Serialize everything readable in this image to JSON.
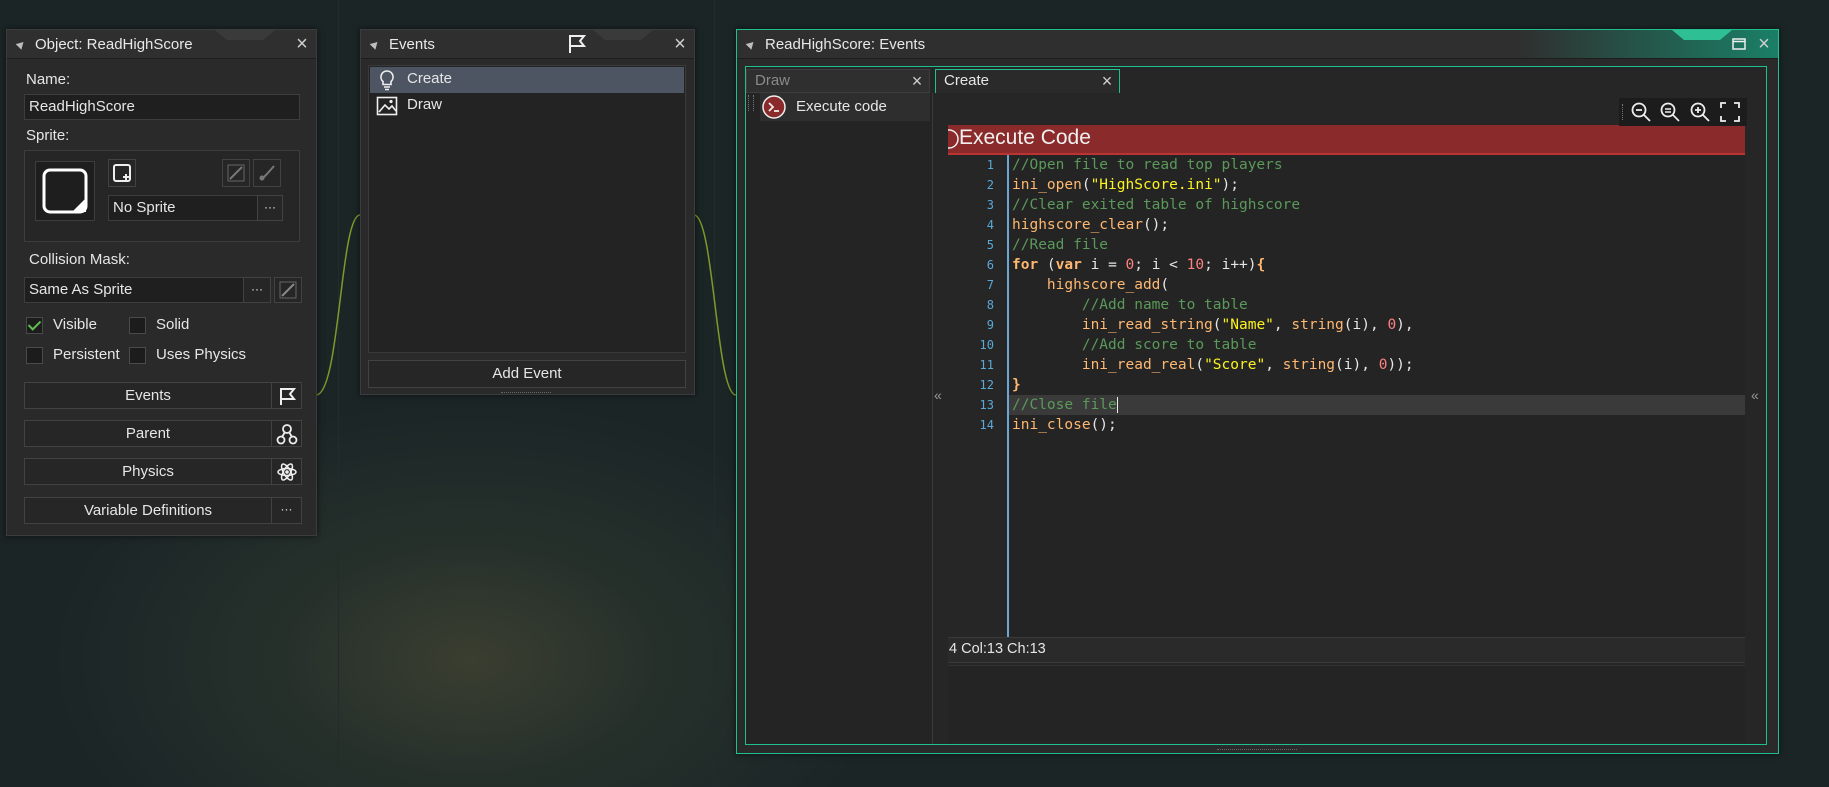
{
  "object_panel": {
    "title": "Object: ReadHighScore",
    "name_label": "Name:",
    "name_value": "ReadHighScore",
    "sprite_label": "Sprite:",
    "sprite_value": "No Sprite",
    "collision_label": "Collision Mask:",
    "collision_value": "Same As Sprite",
    "visible_label": "Visible",
    "visible_checked": true,
    "solid_label": "Solid",
    "persistent_label": "Persistent",
    "physics_label": "Uses Physics",
    "events_btn": "Events",
    "parent_btn": "Parent",
    "physics_btn": "Physics",
    "vardefs_btn": "Variable Definitions",
    "more_glyph": "···"
  },
  "events_panel": {
    "title": "Events",
    "items": [
      {
        "label": "Create",
        "icon": "lightbulb-icon",
        "selected": true
      },
      {
        "label": "Draw",
        "icon": "image-icon",
        "selected": false
      }
    ],
    "add_event_label": "Add Event"
  },
  "code_panel": {
    "title": "ReadHighScore: Events",
    "tabs": [
      {
        "label": "Draw",
        "active": false
      },
      {
        "label": "Create",
        "active": true
      }
    ],
    "action_label": "Execute code",
    "code_header": "Execute Code",
    "status": "4 Col:13 Ch:13",
    "lines": [
      {
        "n": "1",
        "indent": "",
        "tokens": [
          {
            "t": "//Open file to read top players",
            "c": "com"
          }
        ]
      },
      {
        "n": "2",
        "indent": "",
        "tokens": [
          {
            "t": "ini_open",
            "c": "fn"
          },
          {
            "t": "(",
            "c": "plain"
          },
          {
            "t": "\"HighScore.ini\"",
            "c": "str"
          },
          {
            "t": ");",
            "c": "plain"
          }
        ]
      },
      {
        "n": "3",
        "indent": "",
        "tokens": [
          {
            "t": "//Clear exited table of highscore",
            "c": "com"
          }
        ]
      },
      {
        "n": "4",
        "indent": "",
        "tokens": [
          {
            "t": "highscore_clear",
            "c": "fn"
          },
          {
            "t": "();",
            "c": "plain"
          }
        ]
      },
      {
        "n": "5",
        "indent": "",
        "tokens": [
          {
            "t": "//Read file",
            "c": "com"
          }
        ]
      },
      {
        "n": "6",
        "indent": "",
        "tokens": [
          {
            "t": "for",
            "c": "kw"
          },
          {
            "t": " (",
            "c": "plain"
          },
          {
            "t": "var",
            "c": "kw"
          },
          {
            "t": " i = ",
            "c": "plain"
          },
          {
            "t": "0",
            "c": "num"
          },
          {
            "t": "; i < ",
            "c": "plain"
          },
          {
            "t": "10",
            "c": "num"
          },
          {
            "t": "; i++)",
            "c": "plain"
          },
          {
            "t": "{",
            "c": "kw"
          }
        ]
      },
      {
        "n": "7",
        "indent": "    ",
        "tokens": [
          {
            "t": "highscore_add",
            "c": "fn"
          },
          {
            "t": "(",
            "c": "plain"
          }
        ]
      },
      {
        "n": "8",
        "indent": "        ",
        "tokens": [
          {
            "t": "//Add name to table",
            "c": "com"
          }
        ]
      },
      {
        "n": "9",
        "indent": "        ",
        "tokens": [
          {
            "t": "ini_read_string",
            "c": "fn"
          },
          {
            "t": "(",
            "c": "plain"
          },
          {
            "t": "\"Name\"",
            "c": "str"
          },
          {
            "t": ", ",
            "c": "plain"
          },
          {
            "t": "string",
            "c": "fn"
          },
          {
            "t": "(i), ",
            "c": "plain"
          },
          {
            "t": "0",
            "c": "num"
          },
          {
            "t": "),",
            "c": "plain"
          }
        ]
      },
      {
        "n": "10",
        "indent": "        ",
        "tokens": [
          {
            "t": "//Add score to table",
            "c": "com"
          }
        ]
      },
      {
        "n": "11",
        "indent": "        ",
        "tokens": [
          {
            "t": "ini_read_real",
            "c": "fn"
          },
          {
            "t": "(",
            "c": "plain"
          },
          {
            "t": "\"Score\"",
            "c": "str"
          },
          {
            "t": ", ",
            "c": "plain"
          },
          {
            "t": "string",
            "c": "fn"
          },
          {
            "t": "(i), ",
            "c": "plain"
          },
          {
            "t": "0",
            "c": "num"
          },
          {
            "t": "));",
            "c": "plain"
          }
        ]
      },
      {
        "n": "12",
        "indent": "",
        "tokens": [
          {
            "t": "}",
            "c": "kw"
          }
        ]
      },
      {
        "n": "13",
        "indent": "",
        "tokens": [
          {
            "t": "//Close file",
            "c": "com"
          }
        ]
      },
      {
        "n": "14",
        "indent": "",
        "tokens": [
          {
            "t": "ini_close",
            "c": "fn"
          },
          {
            "t": "();",
            "c": "plain"
          }
        ]
      }
    ],
    "current_line": "13"
  },
  "colors": {
    "accent": "#1fbf8f",
    "code_header_red": "#8a2a2a",
    "selection": "#4d5563"
  }
}
